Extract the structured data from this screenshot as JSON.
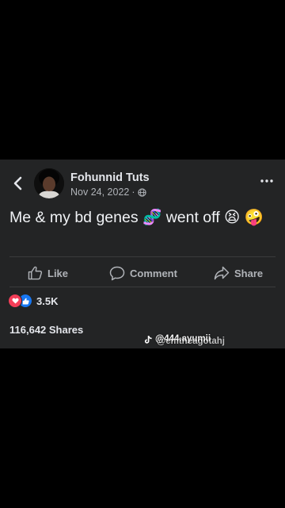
{
  "post": {
    "author": "Fohunnid Tuts",
    "date": "Nov 24, 2022",
    "separator": "·",
    "text": "Me & my bd genes 🧬 went off 😫 🤪"
  },
  "actions": {
    "like_label": "Like",
    "comment_label": "Comment",
    "share_label": "Share"
  },
  "reactions": {
    "count": "3.5K"
  },
  "shares": {
    "label": "116,642 Shares"
  },
  "watermark": {
    "line1": "@444.ayumii",
    "line2": "@emtheagotahj"
  },
  "colors": {
    "background": "#000000",
    "card": "#232425",
    "love": "#f33e58",
    "like": "#1877f2",
    "muted_text": "#b0b3b8"
  },
  "icons": {
    "back": "chevron-left-icon",
    "privacy": "globe-icon",
    "more": "ellipsis-icon",
    "like": "thumbs-up-icon",
    "comment": "speech-bubble-icon",
    "share": "share-arrow-icon",
    "tiktok": "tiktok-icon"
  }
}
